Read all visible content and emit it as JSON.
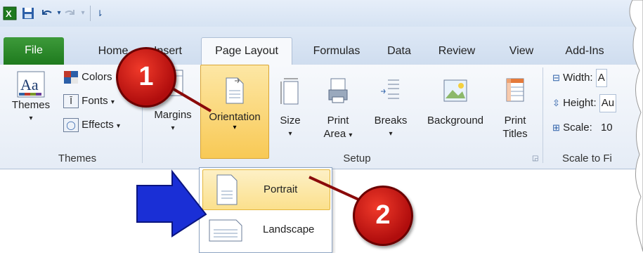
{
  "quick_access": {
    "app_icon": "excel-icon",
    "save_icon": "save-icon",
    "undo_icon": "undo-icon",
    "redo_icon": "redo-icon",
    "customize_icon": "customize-icon"
  },
  "tabs": [
    {
      "label": "File"
    },
    {
      "label": "Home"
    },
    {
      "label": "Insert"
    },
    {
      "label": "Page Layout"
    },
    {
      "label": "Formulas"
    },
    {
      "label": "Data"
    },
    {
      "label": "Review"
    },
    {
      "label": "View"
    },
    {
      "label": "Add-Ins"
    }
  ],
  "themes_group": {
    "themes_label": "Themes",
    "colors_label": "Colors",
    "fonts_label": "Fonts",
    "effects_label": "Effects",
    "group_label": "Themes"
  },
  "page_setup_group": {
    "margins_label": "Margins",
    "orientation_label": "Orientation",
    "size_label": "Size",
    "print_area_label_1": "Print",
    "print_area_label_2": "Area",
    "breaks_label": "Breaks",
    "background_label": "Background",
    "print_titles_label_1": "Print",
    "print_titles_label_2": "Titles",
    "group_label": "Setup"
  },
  "scale_group": {
    "width_label": "Width:",
    "width_value": "A",
    "height_label": "Height:",
    "height_value": "Au",
    "scale_label": "Scale:",
    "scale_value": "10",
    "group_label": "Scale to Fi"
  },
  "orientation_menu": [
    {
      "label": "Portrait",
      "selected": true
    },
    {
      "label": "Landscape",
      "selected": false
    }
  ],
  "callouts": [
    "1",
    "2"
  ],
  "colors": {
    "file_tab": "#2a8a2a",
    "highlight": "#f8c955",
    "callout": "#d01616",
    "arrow": "#1a2fd6"
  }
}
